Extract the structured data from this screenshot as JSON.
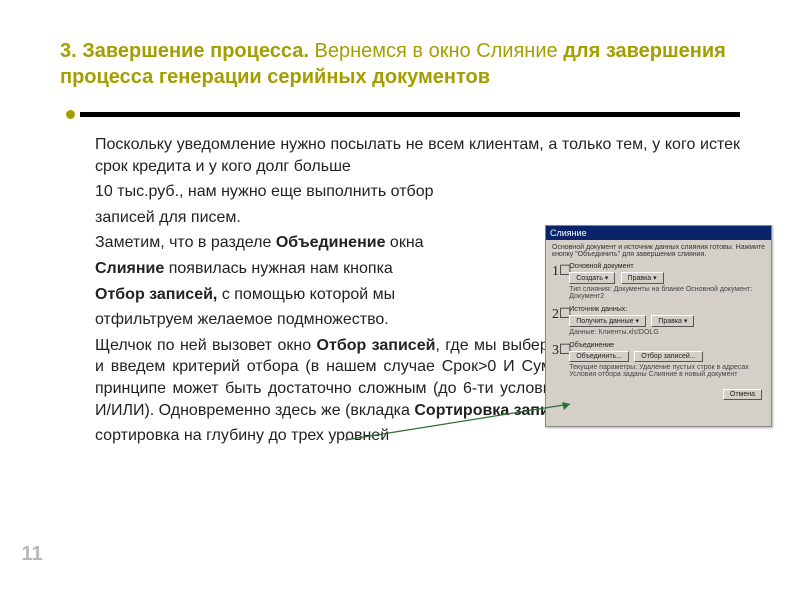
{
  "title": {
    "part1": "3. Завершение процесса.",
    "part2": " Вернемся в окно ",
    "part3": "Слияние",
    "part4": " для завершения процесса генерации серийных документов"
  },
  "body": {
    "p1": "Поскольку уведомление нужно посылать не всем клиентам, а только тем, у кого истек срок кредита и у кого долг больше",
    "p2": "10 тыс.руб., нам нужно еще выполнить отбор",
    "p3": "записей для писем.",
    "p4a": "Заметим, что в разделе ",
    "p4b": "Объединение",
    "p4c": " окна",
    "p5a": "Слияние",
    "p5b": " появилась нужная нам кнопка",
    "p6a": "Отбор записей,",
    "p6b": " с помощью которой мы",
    "p7": "отфильтруем желаемое подмножество.",
    "p8a": "Щелчок по ней вызовет окно ",
    "p8b": "Отбор записей",
    "p8c": ", где мы выберем одноименную вкладку и введем критерий отбора (в нашем случае Срок>0 И Сумма>10). Этот критерий в принципе может быть достаточно сложным (до 6-ти условий, связанных функциями И/ИЛИ). Одновременно здесь же (вкладка ",
    "p8d": "Сортировка записей",
    "p8e": ") возможна и",
    "p9": "сортировка на глубину до трех уровней"
  },
  "dialog": {
    "title": "Слияние",
    "hint": "Основной документ и источник данных слияния готовы. Нажмите кнопку \"Объединить\" для завершения слияния.",
    "sec1": {
      "label": "Основной документ",
      "btn1": "Создать ▾",
      "btn2": "Правка ▾",
      "sub": "Тип слияния: Документы на бланке\nОсновной документ: Документ2"
    },
    "sec2": {
      "label": "Источник данных:",
      "btn1": "Получить данные ▾",
      "btn2": "Правка ▾",
      "sub": "Данные: Клиенты.xls!DOLG"
    },
    "sec3": {
      "label": "Объединение",
      "btn1": "Объединить...",
      "btn2": "Отбор записей...",
      "sub": "Текущие параметры:\nУдаление пустых строк в адресах\nУсловия отбора заданы\nСлияние в новый документ"
    },
    "cancel": "Отмена"
  },
  "page": "11"
}
